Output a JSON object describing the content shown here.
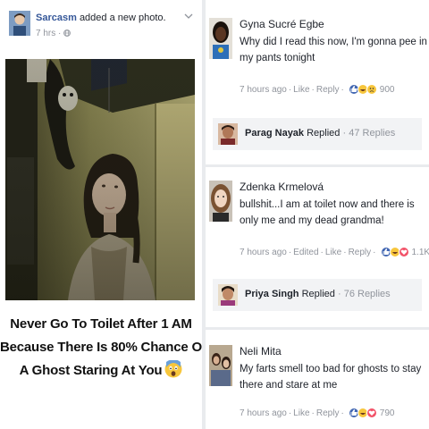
{
  "post": {
    "author": "Sarcasm",
    "action": "added a new photo.",
    "time": "7 hrs",
    "privacy_icon": "globe-icon",
    "menu_icon": "chevron-down-icon",
    "caption_lines": [
      "Never Go To Toilet After 1 AM",
      "Because There Is 80% Chance Of",
      "A Ghost Staring At You"
    ],
    "caption_emoji": "scared-face-emoji"
  },
  "comments": [
    {
      "author": "Gyna Sucré Egbe",
      "text": "Why did I read this now, I'm gonna pee in my pants tonight",
      "time": "7 hours ago",
      "edited": "",
      "like": "Like",
      "reply": "Reply",
      "reactions": [
        "like",
        "haha",
        "sad"
      ],
      "reaction_count": "900",
      "replies": {
        "author": "Parag Nayak",
        "verb": "Replied",
        "count": "47 Replies"
      }
    },
    {
      "author": "Zdenka Krmelová",
      "text": "bullshit...I am at toilet now and there is only me and my dead grandma!",
      "time": "7 hours ago",
      "edited": "Edited",
      "like": "Like",
      "reply": "Reply",
      "reactions": [
        "like",
        "haha",
        "love"
      ],
      "reaction_count": "1.1K",
      "replies": {
        "author": "Priya Singh",
        "verb": "Replied",
        "count": "76 Replies"
      }
    },
    {
      "author": "Neli Mita",
      "text": "My farts smell too bad for ghosts to stay there and stare at me",
      "time": "7 hours ago",
      "edited": "",
      "like": "Like",
      "reply": "Reply",
      "reactions": [
        "like",
        "haha",
        "love"
      ],
      "reaction_count": "790"
    }
  ],
  "colors": {
    "link": "#365899",
    "meta": "#90949c",
    "text": "#1d2129",
    "reply_bg": "#f2f3f5",
    "like": "#4267b2",
    "love": "#f25268",
    "haha": "#f7c63c"
  }
}
